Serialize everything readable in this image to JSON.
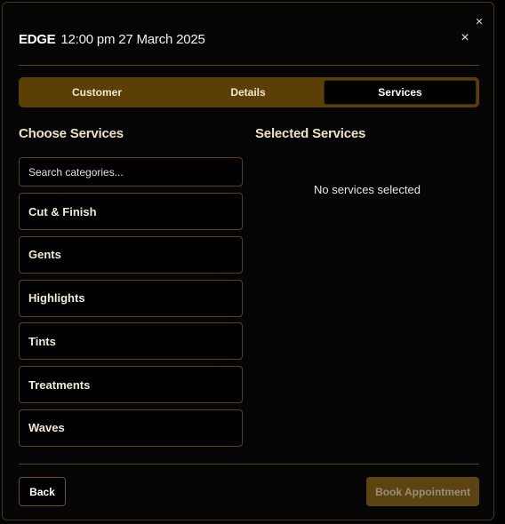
{
  "modal": {
    "outer_close_glyph": "×",
    "inner_close_glyph": "×"
  },
  "header": {
    "brand": "EDGE",
    "datetime": "12:00 pm 27 March 2025"
  },
  "tabs": [
    {
      "label": "Customer",
      "active": false
    },
    {
      "label": "Details",
      "active": false
    },
    {
      "label": "Services",
      "active": true
    }
  ],
  "choose_services": {
    "title": "Choose Services",
    "search_placeholder": "Search categories...",
    "categories": [
      {
        "label": "Cut & Finish"
      },
      {
        "label": "Gents"
      },
      {
        "label": "Highlights"
      },
      {
        "label": "Tints"
      },
      {
        "label": "Treatments"
      },
      {
        "label": "Waves"
      }
    ]
  },
  "selected_services": {
    "title": "Selected Services",
    "empty_text": "No services selected"
  },
  "footer": {
    "back_label": "Back",
    "book_label": "Book Appointment"
  },
  "colors": {
    "accent": "#5c3f05",
    "border": "#5a4218",
    "background": "#050505"
  }
}
